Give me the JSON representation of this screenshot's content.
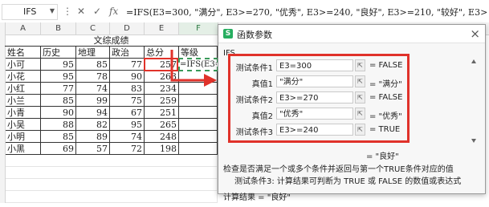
{
  "formula_bar": {
    "cell_ref": "IFS",
    "formula": "=IFS(E3=300, \"满分\", E3>=270, \"优秀\", E3>=240, \"良好\", E3>=210, \"较好\", E3>=180, \"及格\", E3<180, \"不及格\")"
  },
  "sheet": {
    "columns": [
      "A",
      "B",
      "C",
      "D",
      "E",
      "F"
    ],
    "title": "文综成绩",
    "headers": [
      "姓名",
      "历史",
      "地理",
      "政治",
      "总分",
      "等级"
    ],
    "rows": [
      {
        "name": "小可",
        "hist": "95",
        "geo": "85",
        "pol": "77",
        "total": "257",
        "grade": "=IFS(E3=30"
      },
      {
        "name": "小花",
        "hist": "95",
        "geo": "78",
        "pol": "90",
        "total": "263",
        "grade": ""
      },
      {
        "name": "小红",
        "hist": "77",
        "geo": "74",
        "pol": "83",
        "total": "234",
        "grade": ""
      },
      {
        "name": "小兰",
        "hist": "85",
        "geo": "99",
        "pol": "75",
        "total": "259",
        "grade": ""
      },
      {
        "name": "小青",
        "hist": "90",
        "geo": "94",
        "pol": "67",
        "total": "251",
        "grade": ""
      },
      {
        "name": "小吴",
        "hist": "88",
        "geo": "82",
        "pol": "95",
        "total": "265",
        "grade": ""
      },
      {
        "name": "小明",
        "hist": "85",
        "geo": "89",
        "pol": "74",
        "total": "248",
        "grade": ""
      },
      {
        "name": "小黑",
        "hist": "69",
        "geo": "57",
        "pol": "72",
        "total": "198",
        "grade": ""
      }
    ]
  },
  "dialog": {
    "title": "函数参数",
    "function_name": "IFS",
    "params": [
      {
        "label": "测试条件1",
        "value": "E3=300",
        "result": "= FALSE"
      },
      {
        "label": "真值1",
        "value": "\"满分\"",
        "result": "= \"满分\""
      },
      {
        "label": "测试条件2",
        "value": "E3>=270",
        "result": "= FALSE"
      },
      {
        "label": "真值2",
        "value": "\"优秀\"",
        "result": "= \"优秀\""
      },
      {
        "label": "测试条件3",
        "value": "E3>=240",
        "result": "= TRUE"
      }
    ],
    "overall_result": "= \"良好\"",
    "description": "检查是否满足一个或多个条件并返回与第一个TRUE条件对应的值",
    "param_description": "测试条件3: 计算结果可判断为 TRUE 或 FALSE 的数值或表达式",
    "calc_result": "计算结果 = \"良好\""
  },
  "colors": {
    "highlight": "#e0322a",
    "edit_border": "#3a9a5a",
    "logo": "#27ae60"
  }
}
